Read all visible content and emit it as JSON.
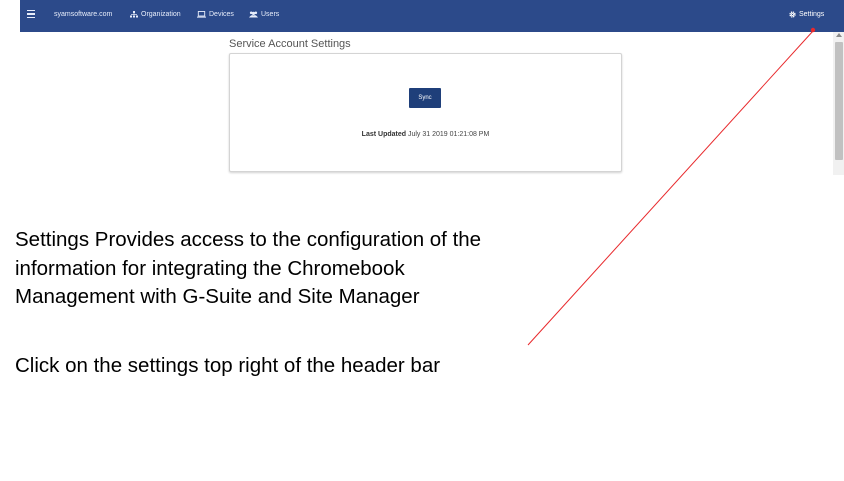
{
  "navbar": {
    "brand": "syamsoftware.com",
    "items": [
      {
        "label": "Organization",
        "icon": "sitemap-icon"
      },
      {
        "label": "Devices",
        "icon": "laptop-icon"
      },
      {
        "label": "Users",
        "icon": "users-icon"
      }
    ],
    "settings_label": "Settings",
    "settings_icon": "gear-icon",
    "background_color": "#2c4a8a"
  },
  "main": {
    "title": "Service Account Settings",
    "sync_button_label": "Sync",
    "last_updated_label": "Last Updated",
    "last_updated_value": "July 31 2019 01:21:08 PM"
  },
  "annotation": {
    "lines": [
      "Settings Provides access to the configuration of the",
      "information for integrating the Chromebook",
      "Management with G-Suite and Site Manager"
    ],
    "instruction": "Click on the settings top right of the header bar",
    "pointer_color": "#e8292c"
  }
}
